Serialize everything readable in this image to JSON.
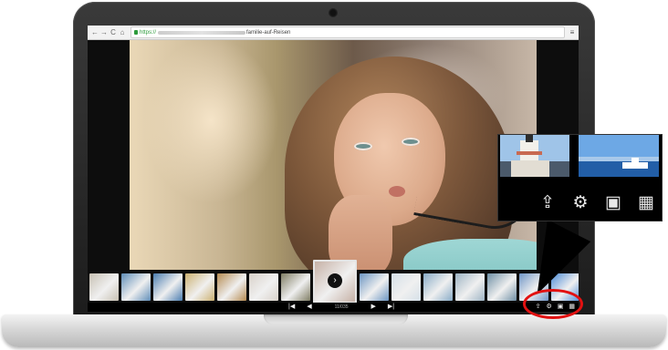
{
  "browser": {
    "back": "←",
    "forward": "→",
    "reload": "C",
    "home": "⌂",
    "scheme": "https://",
    "url_suffix": "familie-auf-Reisen",
    "menu": "≡"
  },
  "viewer": {
    "pager": {
      "first": "|◀",
      "prev": "◀",
      "count": "11/035",
      "next": "▶",
      "last": "▶|"
    },
    "footer_icons": [
      "share-icon",
      "settings-icon",
      "fullscreen-icon",
      "grid-icon"
    ],
    "thumbnails": [
      {
        "color": "#c8c1b4"
      },
      {
        "color": "#5f8db8"
      },
      {
        "color": "#4b7db0"
      },
      {
        "color": "#ccb171"
      },
      {
        "color": "#b68b52"
      },
      {
        "color": "#d9d2ca"
      },
      {
        "color": "#7f7d64"
      },
      {
        "color": "#c6b1a6",
        "active": true
      },
      {
        "color": "#6c95c2"
      },
      {
        "color": "#d5e0e8"
      },
      {
        "color": "#88abc7"
      },
      {
        "color": "#9eb4c4"
      },
      {
        "color": "#6f8fa5"
      },
      {
        "color": "#6f95c6"
      },
      {
        "color": "#4b8bd6"
      }
    ]
  },
  "callout": {
    "share": "⇪",
    "settings": "⚙",
    "fullscreen": "▣",
    "grid": "▦",
    "preview_a": {
      "sky": "#9fc4e8",
      "building": "#f2f0ea",
      "water": "#4b5a6b"
    },
    "preview_b": {
      "sky": "#6da8e5",
      "water": "#225ea7"
    }
  },
  "colors": {
    "highlight": "#e21111",
    "browser_secure": "#2e9b3c"
  }
}
